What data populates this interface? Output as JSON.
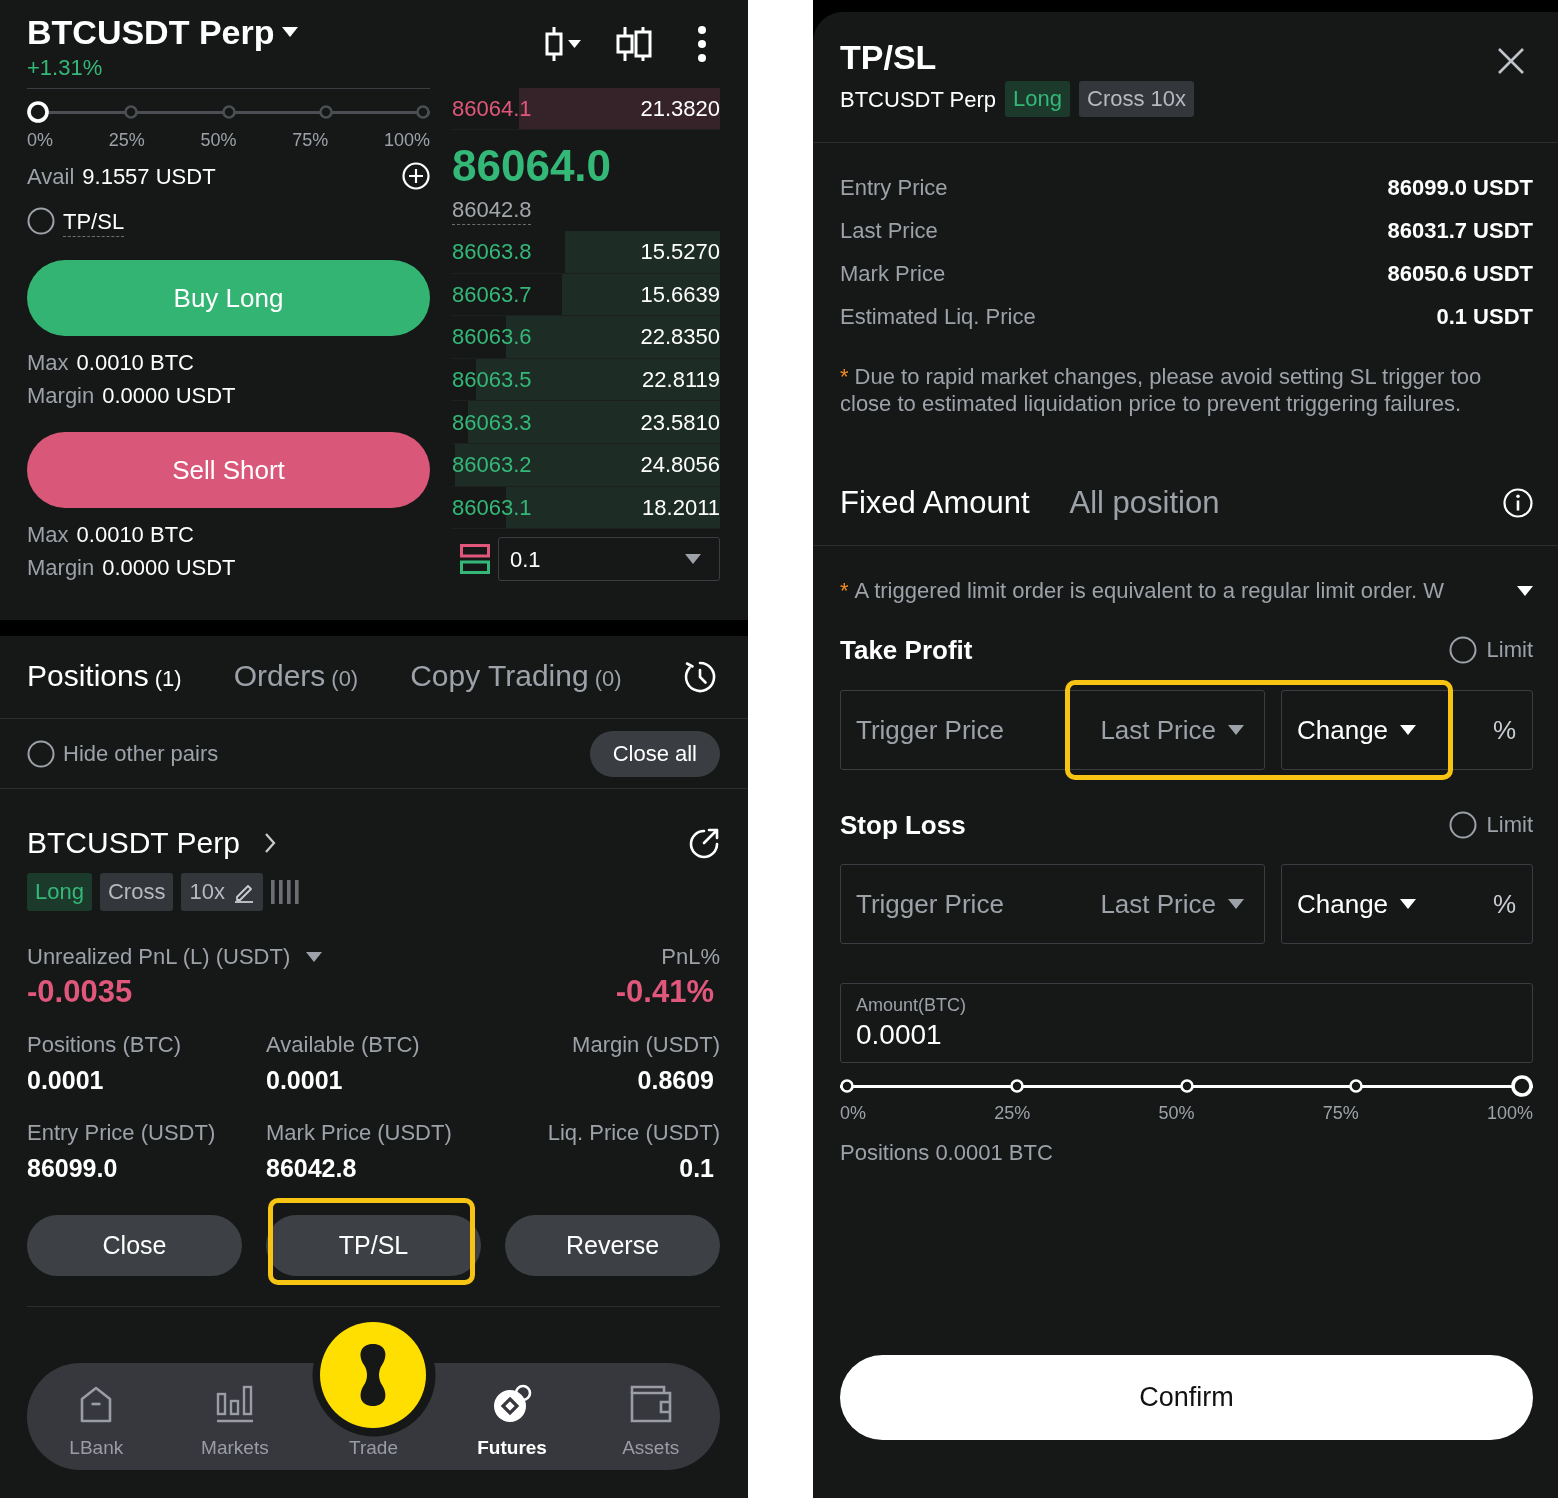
{
  "trade_form": {
    "symbol": "BTCUSDT Perp",
    "change": "+1.31%",
    "amount_slider": {
      "level": 0,
      "stops": [
        "0%",
        "25%",
        "50%",
        "75%",
        "100%"
      ]
    },
    "available": {
      "label": "Avail",
      "value": "9.1557 USDT"
    },
    "tpsl": {
      "label": "TP/SL",
      "checked": false
    },
    "orders": [
      {
        "kind": "buy",
        "label": "Buy Long",
        "max_label": "Max",
        "max_value": "0.0010 BTC",
        "margin_label": "Margin",
        "margin_value": "0.0000 USDT"
      },
      {
        "kind": "sell",
        "label": "Sell Short",
        "max_label": "Max",
        "max_value": "0.0010 BTC",
        "margin_label": "Margin",
        "margin_value": "0.0000 USDT"
      }
    ]
  },
  "order_book": {
    "asks": [
      {
        "price": "86064.1",
        "amount": "21.3820",
        "level": 0.75
      }
    ],
    "last_price": "86064.0",
    "mark_price": "86042.8",
    "bids": [
      {
        "price": "86063.8",
        "amount": "15.5270",
        "level": 0.58
      },
      {
        "price": "86063.7",
        "amount": "15.6639",
        "level": 0.59
      },
      {
        "price": "86063.6",
        "amount": "22.8350",
        "level": 0.8
      },
      {
        "price": "86063.5",
        "amount": "22.8119",
        "level": 0.91
      },
      {
        "price": "86063.3",
        "amount": "23.5810",
        "level": 0.94
      },
      {
        "price": "86063.2",
        "amount": "24.8056",
        "level": 0.99
      },
      {
        "price": "86063.1",
        "amount": "18.2011",
        "level": 0.8
      }
    ],
    "precision": "0.1"
  },
  "position_tabs": [
    {
      "label": "Positions",
      "count": "(1)",
      "selected": true
    },
    {
      "label": "Orders",
      "count": "(0)",
      "selected": false
    },
    {
      "label": "Copy Trading",
      "count": "(0)",
      "selected": false
    }
  ],
  "position_filter": {
    "label": "Hide other pairs",
    "checked": false,
    "close_all": "Close all"
  },
  "position": {
    "symbol": "BTCUSDT Perp",
    "tags": [
      {
        "kind": "long",
        "label": "Long"
      },
      {
        "kind": "margin",
        "label": "Cross"
      },
      {
        "kind": "leverage",
        "label": "10x"
      }
    ],
    "pnl_label": "Unrealized PnL (L) (USDT)",
    "pnl": "-0.0035",
    "pnl_percent_label": "PnL%",
    "pnl_percent": "-0.41%",
    "stats": [
      {
        "label": "Positions (BTC)",
        "value": "0.0001"
      },
      {
        "label": "Available (BTC)",
        "value": "0.0001"
      },
      {
        "label": "Margin (USDT)",
        "value": "0.8609"
      },
      {
        "label": "Entry Price (USDT)",
        "value": "86099.0"
      },
      {
        "label": "Mark Price (USDT)",
        "value": "86042.8"
      },
      {
        "label": "Liq. Price (USDT)",
        "value": "0.1"
      }
    ],
    "buttons": [
      {
        "label": "Close",
        "highlighted": false
      },
      {
        "label": "TP/SL",
        "highlighted": true
      },
      {
        "label": "Reverse",
        "highlighted": false
      }
    ]
  },
  "bottom_nav": [
    {
      "kind": "home",
      "label": "LBank",
      "selected": false
    },
    {
      "kind": "markets",
      "label": "Markets",
      "selected": false
    },
    {
      "kind": "trade",
      "label": "Trade",
      "selected": false
    },
    {
      "kind": "futures",
      "label": "Futures",
      "selected": true
    },
    {
      "kind": "assets",
      "label": "Assets",
      "selected": false
    }
  ],
  "tpsl_dialog": {
    "title": "TP/SL",
    "symbol": "BTCUSDT Perp",
    "tags": [
      {
        "kind": "long",
        "label": "Long"
      },
      {
        "kind": "margin",
        "label": "Cross 10x"
      }
    ],
    "details": [
      {
        "label": "Entry Price",
        "value": "86099.0 USDT"
      },
      {
        "label": "Last Price",
        "value": "86031.7 USDT"
      },
      {
        "label": "Mark Price",
        "value": "86050.6 USDT"
      },
      {
        "label": "Estimated Liq. Price",
        "value": "0.1 USDT"
      }
    ],
    "warning": {
      "mark": "*",
      "text": "Due to rapid market changes, please avoid setting SL trigger too close to estimated liquidation price to prevent triggering failures."
    },
    "modes": [
      {
        "label": "Fixed Amount",
        "selected": true
      },
      {
        "label": "All position",
        "selected": false
      }
    ],
    "limit_note": {
      "mark": "*",
      "text": "A triggered limit order is equivalent to a regular limit order. W"
    },
    "sections": [
      {
        "title": "Take Profit",
        "limit_label": "Limit",
        "limit_checked": false,
        "placeholder": "Trigger Price",
        "price_type": "Last Price",
        "change_type": "Change",
        "unit": "%",
        "highlighted": true
      },
      {
        "title": "Stop Loss",
        "limit_label": "Limit",
        "limit_checked": false,
        "placeholder": "Trigger Price",
        "price_type": "Last Price",
        "change_type": "Change",
        "unit": "%",
        "highlighted": false
      }
    ],
    "amount": {
      "label": "Amount(BTC)",
      "value": "0.0001"
    },
    "amount_slider": {
      "level": 1,
      "stops": [
        "0%",
        "25%",
        "50%",
        "75%",
        "100%"
      ]
    },
    "positions": "Positions 0.0001 BTC",
    "confirm": "Confirm"
  }
}
